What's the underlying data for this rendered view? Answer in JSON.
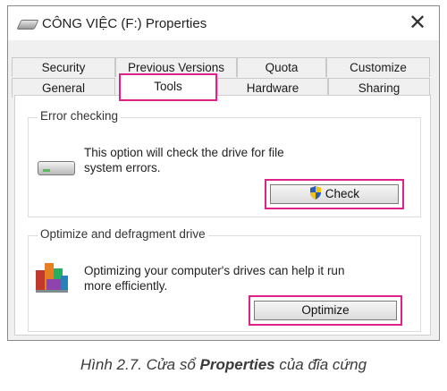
{
  "window": {
    "title": "CÔNG VIỆC (F:) Properties",
    "close_symbol": "✕"
  },
  "tabs": {
    "row1": [
      {
        "label": "Security"
      },
      {
        "label": "Previous Versions"
      },
      {
        "label": "Quota"
      },
      {
        "label": "Customize"
      }
    ],
    "row2": [
      {
        "label": "General"
      },
      {
        "label": "Tools",
        "selected": true
      },
      {
        "label": "Hardware"
      },
      {
        "label": "Sharing"
      }
    ]
  },
  "error_checking": {
    "title": "Error checking",
    "description_line1": "This option will check the drive for file",
    "description_line2": "system errors.",
    "button_label": "Check",
    "icon": "drive-icon",
    "button_icon": "uac-shield-icon"
  },
  "optimize": {
    "title": "Optimize and defragment drive",
    "description_line1": "Optimizing your computer's drives can help it run",
    "description_line2": "more efficiently.",
    "button_label": "Optimize",
    "icon": "defrag-icon"
  },
  "caption": {
    "prefix": "Hình 2.7. Cửa sổ ",
    "bold": "Properties",
    "suffix": " của đĩa cứng"
  },
  "colors": {
    "highlight": "#e0218a",
    "dialog_bg": "#f0f0f0",
    "panel_bg": "#ffffff"
  }
}
